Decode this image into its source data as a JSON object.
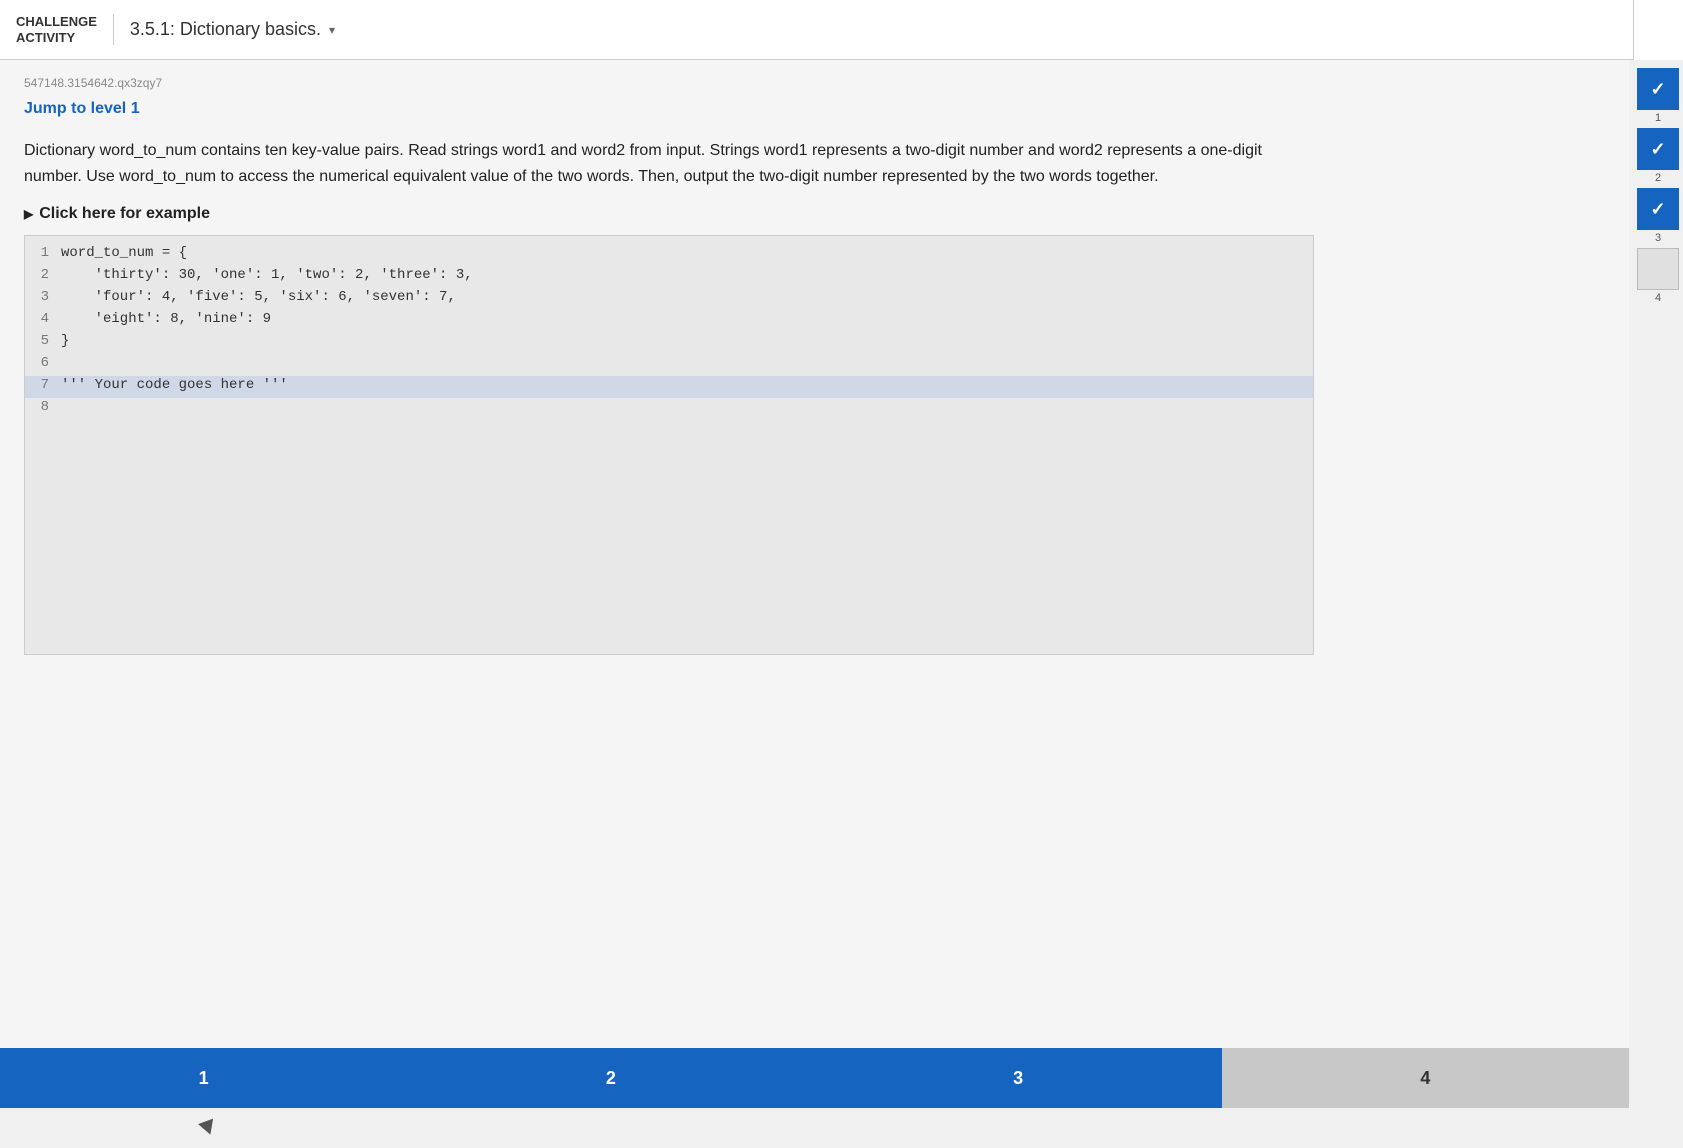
{
  "header": {
    "challenge_line1": "CHALLENGE",
    "challenge_line2": "ACTIVITY",
    "title": "3.5.1: Dictionary basics.",
    "dropdown_icon": "▾"
  },
  "activity": {
    "id": "547148.3154642.qx3zqy7",
    "jump_link": "Jump to level 1",
    "description": "Dictionary word_to_num contains ten key-value pairs. Read strings word1 and word2 from input. Strings word1 represents a two-digit number and word2 represents a one-digit number. Use word_to_num to access the numerical equivalent value of the two words. Then, output the two-digit number represented by the two words together.",
    "example_link": "Click here for example"
  },
  "code": {
    "lines": [
      {
        "num": "1",
        "content": "word_to_num = {",
        "highlighted": false
      },
      {
        "num": "2",
        "content": "    'thirty': 30, 'one': 1, 'two': 2, 'three': 3,",
        "highlighted": false
      },
      {
        "num": "3",
        "content": "    'four': 4, 'five': 5, 'six': 6, 'seven': 7,",
        "highlighted": false
      },
      {
        "num": "4",
        "content": "    'eight': 8, 'nine': 9",
        "highlighted": false
      },
      {
        "num": "5",
        "content": "}",
        "highlighted": false
      },
      {
        "num": "6",
        "content": "",
        "highlighted": false
      },
      {
        "num": "7",
        "content": "''' Your code goes here '''",
        "highlighted": true
      },
      {
        "num": "8",
        "content": "",
        "highlighted": false
      }
    ]
  },
  "tabs": [
    {
      "label": "1",
      "active": true
    },
    {
      "label": "2",
      "active": true
    },
    {
      "label": "3",
      "active": true
    },
    {
      "label": "4",
      "active": false
    }
  ],
  "sidebar": {
    "items": [
      {
        "label": "1",
        "checked": true
      },
      {
        "label": "2",
        "checked": true
      },
      {
        "label": "3",
        "checked": true
      },
      {
        "label": "4",
        "empty": true
      }
    ]
  }
}
